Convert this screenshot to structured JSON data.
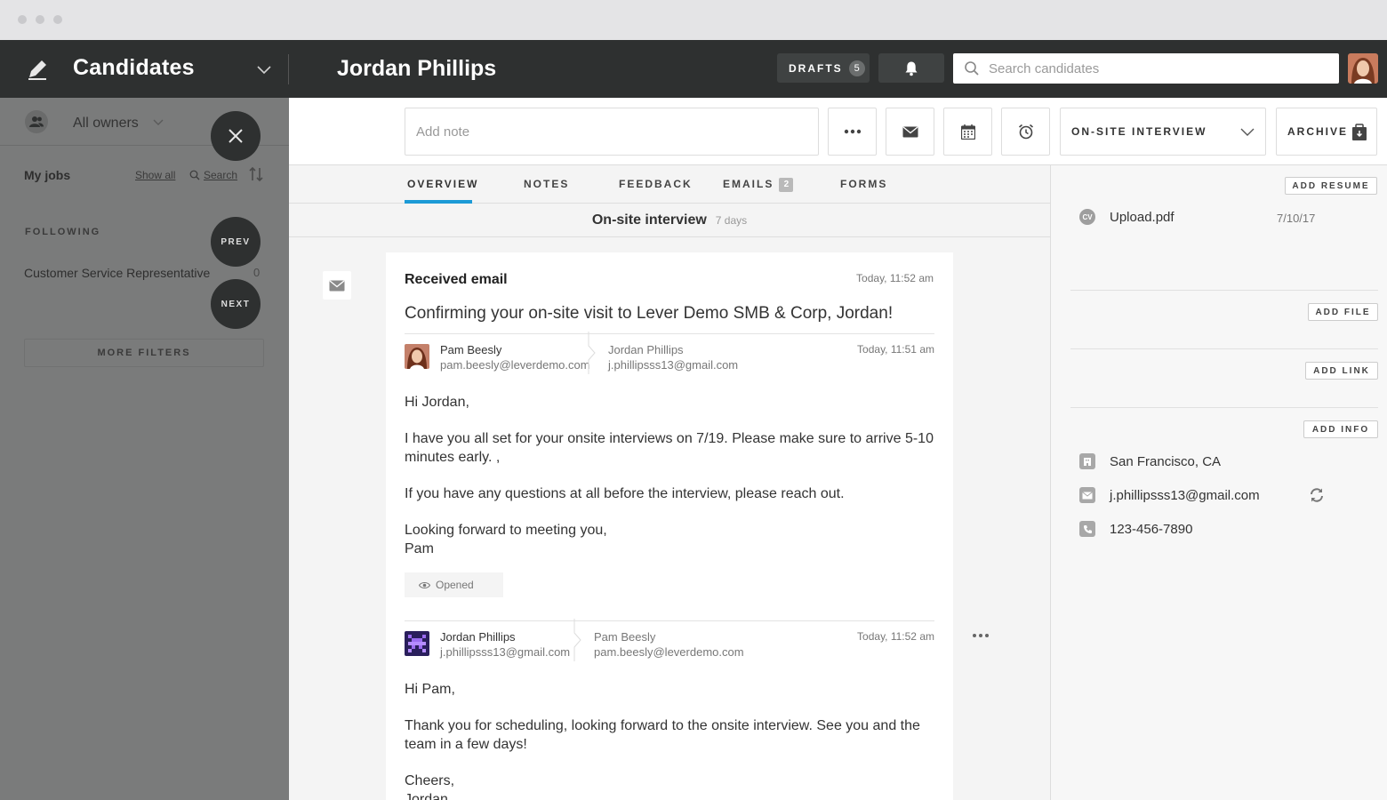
{
  "app": {
    "title": "Candidates",
    "candidate_name": "Jordan Phillips"
  },
  "topbar": {
    "drafts_label": "DRAFTS",
    "drafts_count": "5",
    "search_placeholder": "Search candidates"
  },
  "sidebar": {
    "owners_label": "All owners",
    "my_jobs": "My jobs",
    "show_all": "Show all",
    "search": "Search",
    "following_label": "FOLLOWING",
    "jobs": [
      {
        "title": "Customer Service Representative",
        "count": "0"
      }
    ],
    "more_filters": "MORE FILTERS",
    "prev_label": "PREV",
    "next_label": "NEXT"
  },
  "action_bar": {
    "note_placeholder": "Add note",
    "stage": "ON-SITE INTERVIEW",
    "archive": "ARCHIVE"
  },
  "tabs": [
    {
      "label": "OVERVIEW",
      "active": true
    },
    {
      "label": "NOTES"
    },
    {
      "label": "FEEDBACK"
    },
    {
      "label": "EMAILS",
      "badge": "2"
    },
    {
      "label": "FORMS"
    }
  ],
  "stage_row": {
    "name": "On-site interview",
    "duration": "7 days"
  },
  "email_thread": {
    "heading": "Received email",
    "heading_time": "Today, 11:52 am",
    "subject": "Confirming your on-site visit to Lever Demo SMB & Corp, Jordan!",
    "messages": [
      {
        "from_name": "Pam Beesly",
        "from_email": "pam.beesly@leverdemo.com",
        "to_name": "Jordan Phillips",
        "to_email": "j.phillipsss13@gmail.com",
        "time": "Today, 11:51 am",
        "body": [
          "Hi Jordan,",
          "I have you all set for your onsite interviews on 7/19. Please make sure to arrive 5-10 minutes early. ,",
          "If you have any questions at all before the interview, please reach out.",
          "Looking forward to meeting you,",
          "Pam"
        ],
        "status": "Opened"
      },
      {
        "from_name": "Jordan Phillips",
        "from_email": "j.phillipsss13@gmail.com",
        "to_name": "Pam Beesly",
        "to_email": "pam.beesly@leverdemo.com",
        "time": "Today, 11:52 am",
        "body": [
          "Hi Pam,",
          "Thank you for scheduling, looking forward to the onsite interview. See you and the team in a few days!",
          "Cheers,",
          "Jordan"
        ]
      }
    ]
  },
  "right_panel": {
    "add_resume": "ADD RESUME",
    "resume": {
      "icon": "CV",
      "name": "Upload.pdf",
      "date": "7/10/17"
    },
    "add_file": "ADD FILE",
    "add_link": "ADD LINK",
    "add_info": "ADD INFO",
    "location": "San Francisco, CA",
    "email": "j.phillipsss13@gmail.com",
    "phone": "123-456-7890"
  },
  "colors": {
    "topbar": "#2e3030",
    "sidebar": "#7a7b7b",
    "accent": "#1c9ad6"
  }
}
